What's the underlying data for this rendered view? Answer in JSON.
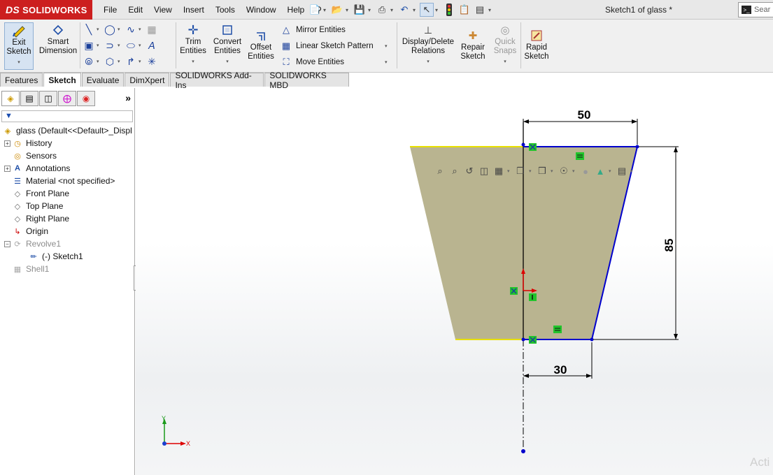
{
  "app": {
    "brand": "SOLIDWORKS",
    "brand_prefix": "DS",
    "document_title": "Sketch1 of glass *",
    "search_placeholder": "Sear"
  },
  "menu": [
    "File",
    "Edit",
    "View",
    "Insert",
    "Tools",
    "Window",
    "Help"
  ],
  "command_manager": {
    "exit_sketch": [
      "Exit",
      "Sketch"
    ],
    "smart_dimension": [
      "Smart",
      "Dimension"
    ],
    "trim_entities": [
      "Trim",
      "Entities"
    ],
    "convert_entities": [
      "Convert",
      "Entities"
    ],
    "offset_entities": [
      "Offset",
      "Entities"
    ],
    "mirror_entities": "Mirror Entities",
    "linear_sketch_pattern": "Linear Sketch Pattern",
    "move_entities": "Move Entities",
    "display_delete_relations": [
      "Display/Delete",
      "Relations"
    ],
    "repair_sketch": [
      "Repair",
      "Sketch"
    ],
    "quick_snaps": [
      "Quick",
      "Snaps"
    ],
    "rapid_sketch": [
      "Rapid",
      "Sketch"
    ]
  },
  "tabs": [
    "Features",
    "Sketch",
    "Evaluate",
    "DimXpert",
    "SOLIDWORKS Add-Ins",
    "SOLIDWORKS MBD"
  ],
  "active_tab": "Sketch",
  "feature_tree": {
    "root": "glass  (Default<<Default>_Displ",
    "items": [
      {
        "label": "History"
      },
      {
        "label": "Sensors"
      },
      {
        "label": "Annotations"
      },
      {
        "label": "Material <not specified>"
      },
      {
        "label": "Front Plane"
      },
      {
        "label": "Top Plane"
      },
      {
        "label": "Right Plane"
      },
      {
        "label": "Origin"
      },
      {
        "label": "Revolve1"
      },
      {
        "label": "(-) Sketch1"
      },
      {
        "label": "Shell1"
      }
    ]
  },
  "sketch": {
    "dim_top_width": "50",
    "dim_height": "85",
    "dim_bottom_width": "30",
    "triad_y": "Y",
    "triad_x": "X",
    "fill_color": "#b5b08a",
    "line_color": "#0000cc",
    "edge_highlight": "#e8e000"
  },
  "watermark": "Acti"
}
